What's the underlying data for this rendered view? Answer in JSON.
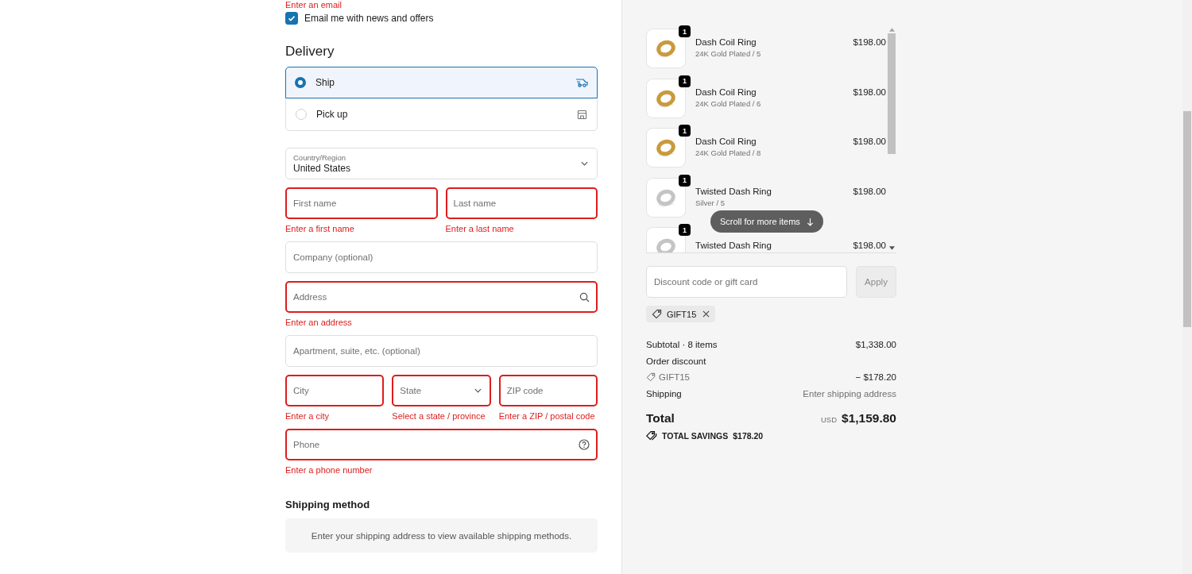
{
  "contact": {
    "email_error": "Enter an email",
    "newsletter": {
      "label": "Email me with news and offers",
      "checked": true
    }
  },
  "delivery": {
    "title": "Delivery",
    "options": [
      {
        "label": "Ship",
        "selected": true,
        "kind": "ship"
      },
      {
        "label": "Pick up",
        "selected": false,
        "kind": "pickup"
      }
    ]
  },
  "address_form": {
    "country": {
      "label": "Country/Region",
      "value": "United States"
    },
    "rows": [
      [
        {
          "placeholder": "First name",
          "kind": "text",
          "error": "Enter a first name"
        },
        {
          "placeholder": "Last name",
          "kind": "text",
          "error": "Enter a last name"
        }
      ],
      [
        {
          "placeholder": "Company (optional)",
          "kind": "text"
        }
      ],
      [
        {
          "placeholder": "Address",
          "kind": "search",
          "error": "Enter an address"
        }
      ],
      [
        {
          "placeholder": "Apartment, suite, etc. (optional)",
          "kind": "text"
        }
      ],
      [
        {
          "placeholder": "City",
          "kind": "text",
          "error": "Enter a city"
        },
        {
          "placeholder": "State",
          "kind": "select",
          "error": "Select a state / province"
        },
        {
          "placeholder": "ZIP code",
          "kind": "text",
          "error": "Enter a ZIP / postal code"
        }
      ],
      [
        {
          "placeholder": "Phone",
          "kind": "help",
          "error": "Enter a phone number"
        }
      ]
    ]
  },
  "shipping_method": {
    "title": "Shipping method",
    "message": "Enter your shipping address to view available shipping methods."
  },
  "cart": {
    "items": [
      {
        "name": "Dash Coil Ring",
        "variant": "24K Gold Plated / 5",
        "price": "$198.00",
        "quantity": "1",
        "kind": "gold"
      },
      {
        "name": "Dash Coil Ring",
        "variant": "24K Gold Plated / 6",
        "price": "$198.00",
        "quantity": "1",
        "kind": "gold"
      },
      {
        "name": "Dash Coil Ring",
        "variant": "24K Gold Plated / 8",
        "price": "$198.00",
        "quantity": "1",
        "kind": "gold"
      },
      {
        "name": "Twisted Dash Ring",
        "variant": "Silver / 5",
        "price": "$198.00",
        "quantity": "1",
        "kind": "silver"
      },
      {
        "name": "Twisted Dash Ring",
        "price": "$198.00",
        "quantity": "1",
        "kind": "silver"
      }
    ],
    "scroll_hint": "Scroll for more items"
  },
  "discount": {
    "placeholder": "Discount code or gift card",
    "button": "Apply",
    "applied_code": "GIFT15"
  },
  "summary": {
    "subtotal_label": "Subtotal · 8 items",
    "subtotal": "$1,338.00",
    "discount_label": "Order discount",
    "discount_code": "GIFT15",
    "discount_amount": "− $178.20",
    "shipping_label": "Shipping",
    "shipping_value": "Enter shipping address",
    "total_label": "Total",
    "currency": "USD",
    "total": "$1,159.80",
    "savings_label": "TOTAL SAVINGS",
    "savings": "$178.20"
  }
}
